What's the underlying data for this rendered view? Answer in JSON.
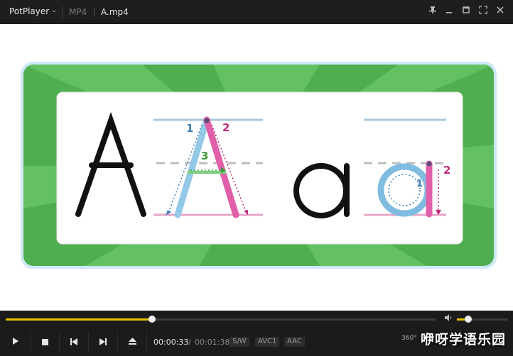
{
  "titlebar": {
    "app_name": "PotPlayer",
    "format": "MP4",
    "file_name": "A.mp4"
  },
  "playback": {
    "current_time": "00:00:33",
    "time_separator": "/",
    "total_time": "00:01:38",
    "progress": 0.34,
    "volume": 0.22
  },
  "tags": [
    "S/W",
    "AVC1",
    "AAC"
  ],
  "vr_label": "360°",
  "watermark": "咿呀学语乐园",
  "video": {
    "number_1": "1",
    "number_2": "2",
    "number_3": "3",
    "number_1_lower": "1",
    "number_2_lower": "2"
  },
  "colors": {
    "accent": "#e6c300",
    "green_bg": "#5cb85c",
    "stroke_pink": "#e2479a",
    "stroke_blue": "#7fbce0",
    "stroke_green": "#5cb85c"
  }
}
